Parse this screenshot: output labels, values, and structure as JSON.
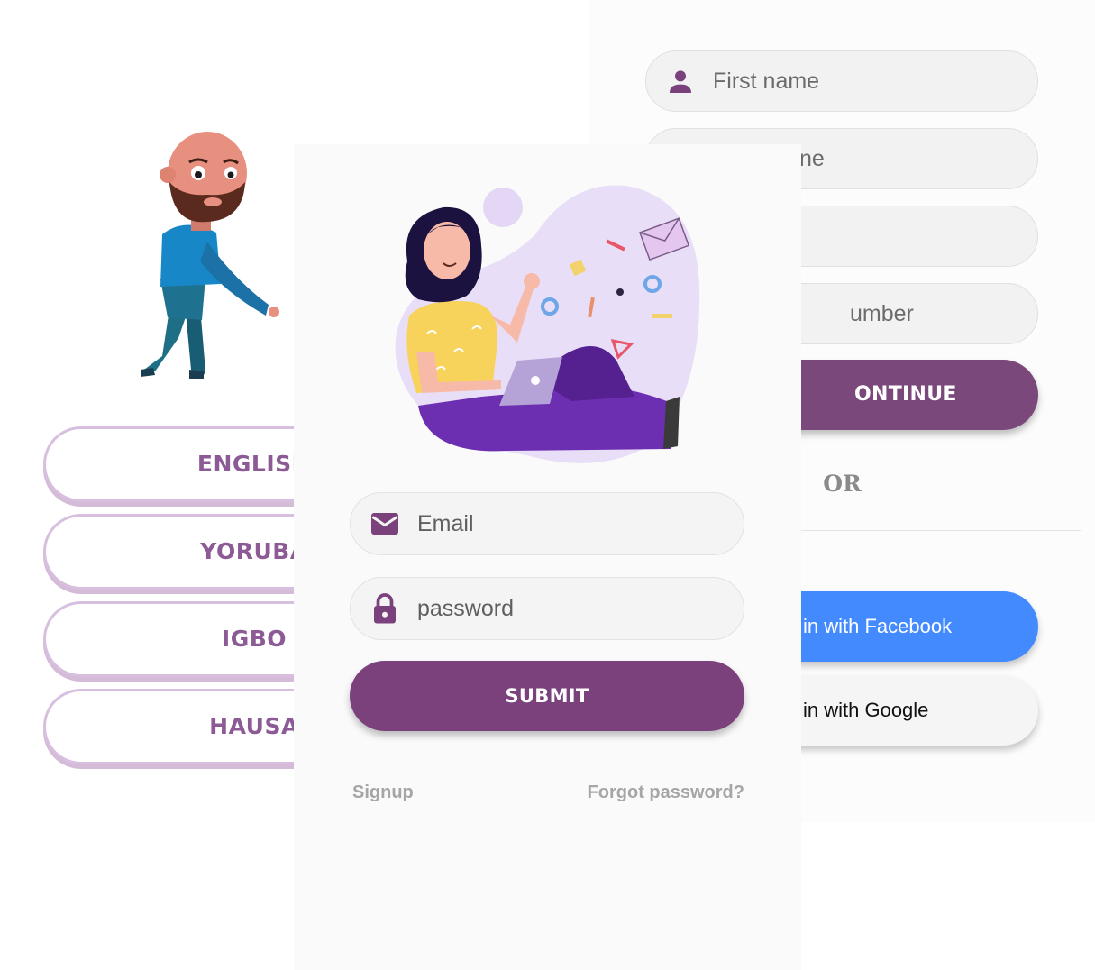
{
  "language_screen": {
    "buttons": [
      {
        "label": "ENGLISH"
      },
      {
        "label": "YORUBA"
      },
      {
        "label": "IGBO"
      },
      {
        "label": "HAUSA"
      }
    ]
  },
  "signup_screen": {
    "first_name_placeholder": "First name",
    "field2_visible": "ne",
    "field4_visible": "umber",
    "continue_label": "ONTINUE",
    "or_label": "OR",
    "facebook_label": "in with Facebook",
    "google_label": "in with Google"
  },
  "login_screen": {
    "email_placeholder": "Email",
    "password_placeholder": "password",
    "submit_label": "SUBMIT",
    "signup_link": "Signup",
    "forgot_link": "Forgot password?"
  },
  "colors": {
    "primary": "#7a417c",
    "facebook": "#448aff",
    "field_bg": "#f4f4f4",
    "language_border": "#d8bfe0"
  }
}
